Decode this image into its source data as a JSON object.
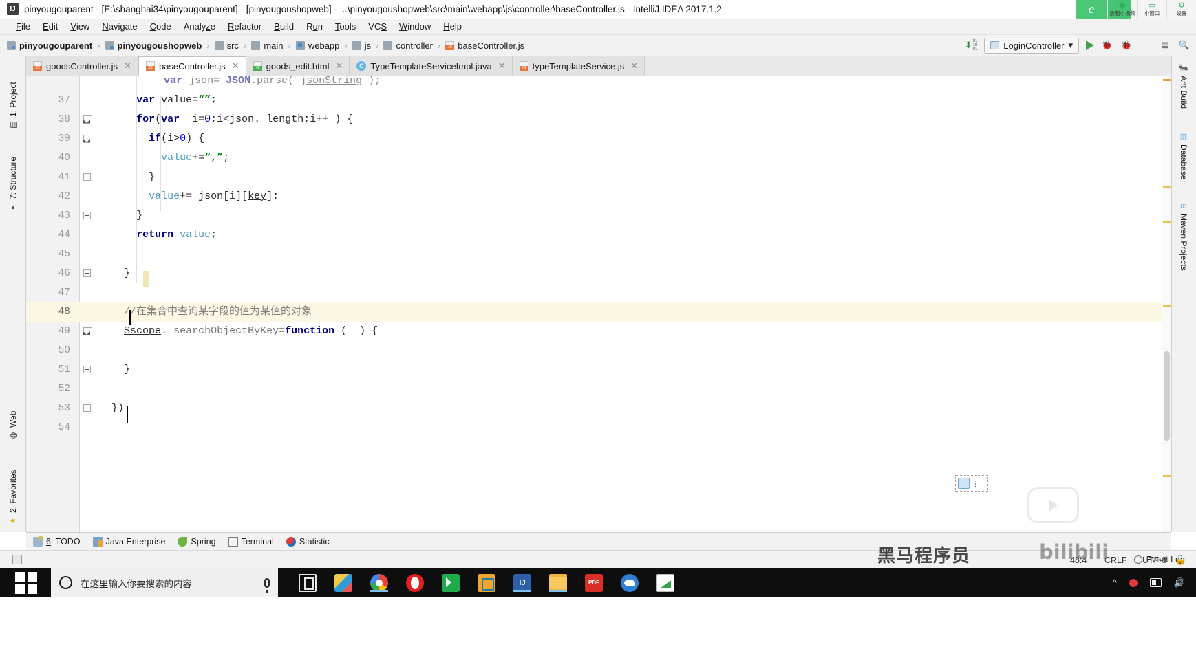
{
  "window": {
    "title": "pinyougouparent - [E:\\shanghai34\\pinyougouparent] - [pinyougoushopweb] - ...\\pinyougoushopweb\\src\\main\\webapp\\js\\controller\\baseController.js - IntelliJ IDEA 2017.1.2",
    "app_icon_label": "IJ"
  },
  "extension_bar": {
    "logo": "e",
    "buttons": [
      {
        "label": "录制小视频",
        "icon": "record-video-icon",
        "glyph": "▣"
      },
      {
        "label": "小窗口",
        "icon": "small-window-icon",
        "glyph": "▭"
      },
      {
        "label": "设置",
        "icon": "gear-icon",
        "glyph": "⚙"
      }
    ]
  },
  "menubar": {
    "items": [
      {
        "label": "File",
        "mnemonic": "F"
      },
      {
        "label": "Edit",
        "mnemonic": "E"
      },
      {
        "label": "View",
        "mnemonic": "V"
      },
      {
        "label": "Navigate",
        "mnemonic": "N"
      },
      {
        "label": "Code",
        "mnemonic": "C"
      },
      {
        "label": "Analyze",
        "mnemonic": "z"
      },
      {
        "label": "Refactor",
        "mnemonic": "R"
      },
      {
        "label": "Build",
        "mnemonic": "B"
      },
      {
        "label": "Run",
        "mnemonic": "u"
      },
      {
        "label": "Tools",
        "mnemonic": "T"
      },
      {
        "label": "VCS",
        "mnemonic": "S"
      },
      {
        "label": "Window",
        "mnemonic": "W"
      },
      {
        "label": "Help",
        "mnemonic": "H"
      }
    ]
  },
  "breadcrumb": {
    "items": [
      {
        "label": "pinyougouparent",
        "icon": "module-folder-icon",
        "bold": true
      },
      {
        "label": "pinyougoushopweb",
        "icon": "module-folder-icon",
        "bold": true
      },
      {
        "label": "src",
        "icon": "folder-icon",
        "bold": false
      },
      {
        "label": "main",
        "icon": "folder-icon",
        "bold": false
      },
      {
        "label": "webapp",
        "icon": "web-folder-icon",
        "bold": false
      },
      {
        "label": "js",
        "icon": "folder-icon",
        "bold": false
      },
      {
        "label": "controller",
        "icon": "folder-icon",
        "bold": false
      },
      {
        "label": "baseController.js",
        "icon": "js-file-icon",
        "bold": false
      }
    ],
    "separator": "›"
  },
  "toolbar_right": {
    "update_icon": "download-update-icon",
    "update_bits": "01\n10\n01",
    "run_configuration": "LoginController",
    "dropdown_glyph": "▾",
    "buttons": [
      {
        "name": "run-button",
        "glyph": "▶"
      },
      {
        "name": "debug-button",
        "glyph": "🐞"
      },
      {
        "name": "run-coverage-button",
        "glyph": "🐞"
      },
      {
        "name": "stop-button",
        "glyph": "■"
      },
      {
        "name": "layout-button",
        "glyph": "▤"
      },
      {
        "name": "search-everywhere-button",
        "glyph": "🔍"
      }
    ]
  },
  "left_tool_strip": {
    "tabs": [
      {
        "label": "1: Project",
        "mnemonic": "1",
        "icon": "project-icon"
      },
      {
        "label": "7: Structure",
        "mnemonic": "7",
        "icon": "structure-icon"
      },
      {
        "label": "Web",
        "icon": "web-icon"
      },
      {
        "label": "2: Favorites",
        "mnemonic": "2",
        "icon": "favorites-star-icon"
      }
    ]
  },
  "right_tool_strip": {
    "tabs": [
      {
        "label": "Ant Build",
        "icon": "ant-icon"
      },
      {
        "label": "Database",
        "icon": "database-icon"
      },
      {
        "label": "Maven Projects",
        "icon": "maven-icon"
      }
    ]
  },
  "editor_tabs": [
    {
      "label": "goodsController.js",
      "icon": "js-file-icon",
      "active": false,
      "close": "✕"
    },
    {
      "label": "baseController.js",
      "icon": "js-file-icon",
      "active": true,
      "close": "✕"
    },
    {
      "label": "goods_edit.html",
      "icon": "html-file-icon",
      "active": false,
      "close": "✕"
    },
    {
      "label": "TypeTemplateServiceImpl.java",
      "icon": "java-class-icon",
      "active": false,
      "close": "✕"
    },
    {
      "label": "typeTemplateService.js",
      "icon": "js-file-icon",
      "active": false,
      "close": "✕"
    }
  ],
  "editor": {
    "first_partial_line": "var json= JSON.parse( jsonString );",
    "lines": [
      {
        "num": "37",
        "indent": 5,
        "fold": null,
        "highlight": false,
        "tokens": [
          {
            "t": "var",
            "c": "kw"
          },
          {
            "t": " value=",
            "c": ""
          },
          {
            "t": "“”",
            "c": "str"
          },
          {
            "t": ";",
            "c": ""
          }
        ]
      },
      {
        "num": "38",
        "indent": 5,
        "fold": "open",
        "highlight": false,
        "tokens": [
          {
            "t": "for",
            "c": "kw"
          },
          {
            "t": "(",
            "c": ""
          },
          {
            "t": "var",
            "c": "kw"
          },
          {
            "t": "  i=",
            "c": ""
          },
          {
            "t": "0",
            "c": "num"
          },
          {
            "t": ";i<json. length;i++ ) {",
            "c": ""
          }
        ]
      },
      {
        "num": "39",
        "indent": 7,
        "fold": "open",
        "highlight": false,
        "tokens": [
          {
            "t": "if",
            "c": "kw"
          },
          {
            "t": "(i>",
            "c": ""
          },
          {
            "t": "0",
            "c": "num"
          },
          {
            "t": ") {",
            "c": ""
          }
        ]
      },
      {
        "num": "40",
        "indent": 9,
        "fold": null,
        "highlight": false,
        "tokens": [
          {
            "t": "value",
            "c": "fld"
          },
          {
            "t": "+=",
            "c": ""
          },
          {
            "t": "“,”",
            "c": "str"
          },
          {
            "t": ";",
            "c": ""
          }
        ]
      },
      {
        "num": "41",
        "indent": 7,
        "fold": "close",
        "highlight": false,
        "tokens": [
          {
            "t": "}",
            "c": ""
          }
        ]
      },
      {
        "num": "42",
        "indent": 7,
        "fold": null,
        "highlight": false,
        "tokens": [
          {
            "t": "value",
            "c": "fld"
          },
          {
            "t": "+= json[i][",
            "c": ""
          },
          {
            "t": "key",
            "c": "ul"
          },
          {
            "t": "];",
            "c": ""
          }
        ]
      },
      {
        "num": "43",
        "indent": 5,
        "fold": "close",
        "highlight": false,
        "tokens": [
          {
            "t": "}",
            "c": ""
          }
        ]
      },
      {
        "num": "44",
        "indent": 5,
        "fold": null,
        "highlight": false,
        "tokens": [
          {
            "t": "return",
            "c": "kw"
          },
          {
            "t": " ",
            "c": ""
          },
          {
            "t": "value",
            "c": "fld"
          },
          {
            "t": ";",
            "c": ""
          }
        ]
      },
      {
        "num": "45",
        "indent": 0,
        "fold": null,
        "highlight": false,
        "tokens": []
      },
      {
        "num": "46",
        "indent": 3,
        "fold": "close",
        "highlight": false,
        "tokens": [
          {
            "t": "}",
            "c": ""
          }
        ]
      },
      {
        "num": "47",
        "indent": 0,
        "fold": null,
        "highlight": false,
        "tokens": []
      },
      {
        "num": "48",
        "indent": 3,
        "fold": null,
        "highlight": true,
        "tokens": [
          {
            "t": "//在集合中查询某字段的值为某值的对象",
            "c": "cmt"
          }
        ]
      },
      {
        "num": "49",
        "indent": 3,
        "fold": "open",
        "highlight": false,
        "tokens": [
          {
            "t": "$scope",
            "c": "ul"
          },
          {
            "t": ". ",
            "c": ""
          },
          {
            "t": "searchObjectByKey",
            "c": "prop"
          },
          {
            "t": "=",
            "c": ""
          },
          {
            "t": "function",
            "c": "kw"
          },
          {
            "t": " (  ) {",
            "c": ""
          }
        ]
      },
      {
        "num": "50",
        "indent": 0,
        "fold": null,
        "highlight": false,
        "tokens": []
      },
      {
        "num": "51",
        "indent": 3,
        "fold": "close",
        "highlight": false,
        "tokens": [
          {
            "t": "}",
            "c": ""
          }
        ]
      },
      {
        "num": "52",
        "indent": 0,
        "fold": null,
        "highlight": false,
        "tokens": []
      },
      {
        "num": "53",
        "indent": 1,
        "fold": "close",
        "highlight": false,
        "tokens": [
          {
            "t": "})",
            "c": ""
          }
        ]
      },
      {
        "num": "54",
        "indent": 0,
        "fold": null,
        "highlight": false,
        "tokens": []
      }
    ]
  },
  "tool_window_bar": {
    "items": [
      {
        "label": "6: TODO",
        "mnemonic": "6",
        "icon": "todo-icon"
      },
      {
        "label": "Java Enterprise",
        "icon": "java-enterprise-icon"
      },
      {
        "label": "Spring",
        "icon": "spring-leaf-icon"
      },
      {
        "label": "Terminal",
        "icon": "terminal-icon"
      },
      {
        "label": "Statistic",
        "icon": "statistic-icon"
      }
    ]
  },
  "status_bar": {
    "event_log": "Event Log",
    "event_log_icon": "balloon-icon",
    "caret_position": "48:4",
    "line_separator": "CRLF",
    "encoding": "UTF-8",
    "lock_icon": "unlocked-icon",
    "inspection_icon": "inspections-icon"
  },
  "watermark": {
    "text": "黑马程序员",
    "text2": "bilibili"
  },
  "taskbar": {
    "start_icon": "windows-start-icon",
    "cortana_icon": "cortana-circle-icon",
    "search_placeholder": "在这里输入你要搜索的内容",
    "mic_icon": "microphone-icon",
    "task_view_icon": "task-view-icon",
    "pinned": [
      {
        "name": "paint-3d-icon"
      },
      {
        "name": "google-chrome-icon"
      },
      {
        "name": "opera-browser-icon"
      },
      {
        "name": "wps-icon"
      },
      {
        "name": "teamviewer-icon"
      },
      {
        "name": "intellij-idea-icon"
      },
      {
        "name": "file-explorer-icon"
      },
      {
        "name": "pdf-reader-icon"
      },
      {
        "name": "thunderbird-icon"
      },
      {
        "name": "chart-app-icon"
      }
    ],
    "tray": [
      {
        "name": "chevron-up-icon",
        "glyph": "^"
      },
      {
        "name": "notification-red-icon",
        "glyph": ""
      },
      {
        "name": "display-icon",
        "glyph": ""
      },
      {
        "name": "volume-icon",
        "glyph": "🔊"
      }
    ]
  }
}
